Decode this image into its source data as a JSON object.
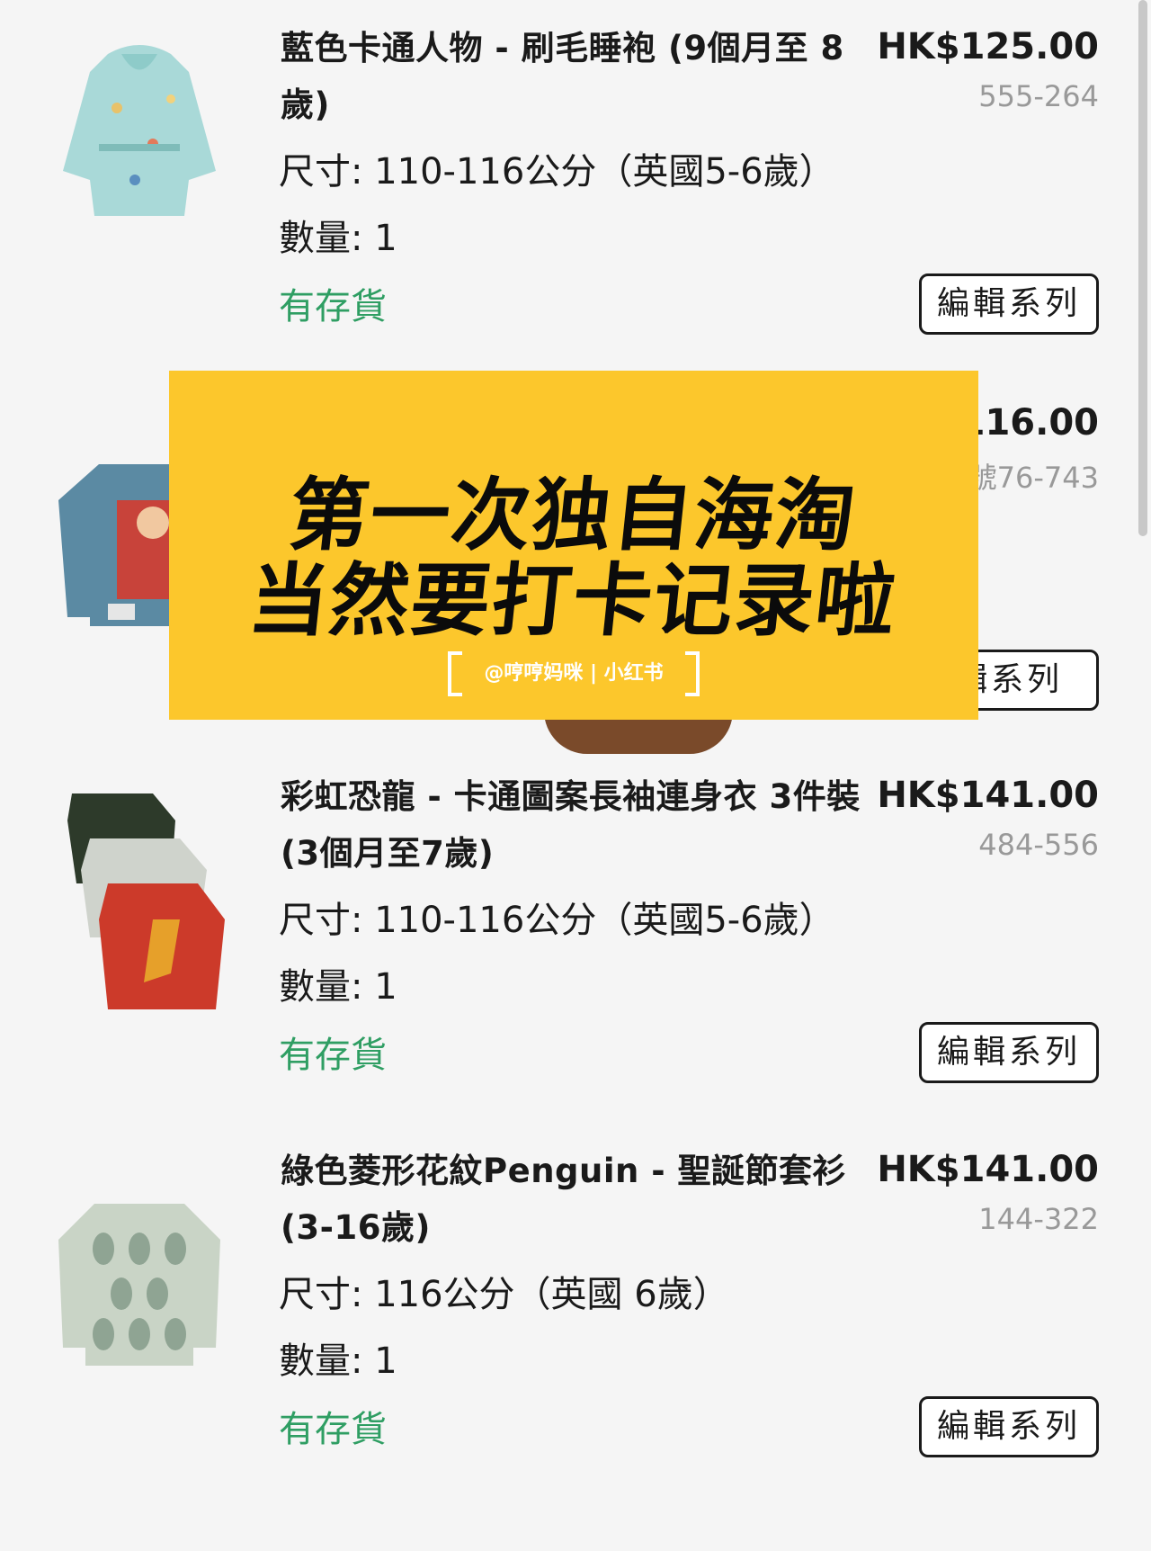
{
  "items": [
    {
      "title": "藍色卡通人物 - 刷毛睡袍 (9個月至 8歲)",
      "price": "HK$125.00",
      "sku": "555-264",
      "size": "尺寸: 110-116公分（英國5-6歲）",
      "qty": "數量: 1",
      "stock": "有存貨",
      "edit": "編輯系列"
    },
    {
      "title": "",
      "price": "116.00",
      "sku": "號76-743",
      "size": "",
      "qty": "",
      "stock": "",
      "edit": "輯系列"
    },
    {
      "title": "彩虹恐龍 - 卡通圖案長袖連身衣 3件裝 (3個月至7歲)",
      "price": "HK$141.00",
      "sku": "484-556",
      "size": "尺寸: 110-116公分（英國5-6歲）",
      "qty": "數量: 1",
      "stock": "有存貨",
      "edit": "編輯系列"
    },
    {
      "title": "綠色菱形花紋Penguin - 聖誕節套衫 (3-16歲)",
      "price": "HK$141.00",
      "sku": "144-322",
      "size": "尺寸: 116公分（英國 6歲）",
      "qty": "數量: 1",
      "stock": "有存貨",
      "edit": "編輯系列"
    }
  ],
  "banner": {
    "line1": "第一次独自海淘",
    "line2": "当然要打卡记录啦",
    "watermark": "@哼哼妈咪 | 小红书"
  },
  "colors": {
    "in_stock": "#2f9e63",
    "banner_bg": "#fcc72c",
    "sku_gray": "#999999"
  }
}
